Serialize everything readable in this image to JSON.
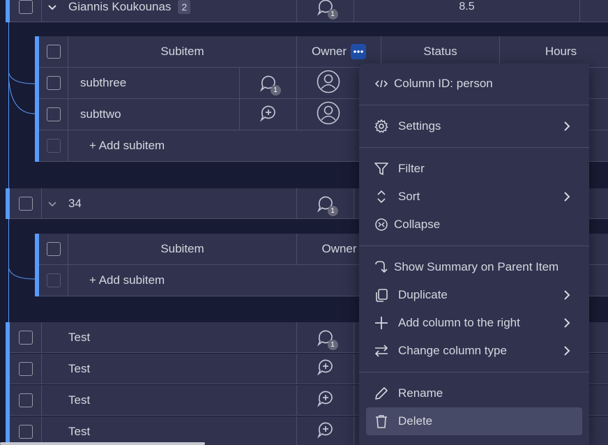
{
  "group1": {
    "name": "Giannis Koukounas",
    "subitem_count": "2",
    "update_count": "1",
    "hours": "8.5"
  },
  "subtable1": {
    "headers": {
      "subitem": "Subitem",
      "owner": "Owner",
      "status": "Status",
      "hours": "Hours"
    },
    "rows": [
      {
        "name": "subthree",
        "update_count": "1"
      },
      {
        "name": "subttwo"
      }
    ],
    "add_label": "+ Add subitem"
  },
  "group2": {
    "name": "34",
    "update_count": "1"
  },
  "subtable2": {
    "headers": {
      "subitem": "Subitem",
      "owner": "Owner"
    },
    "add_label": "+ Add subitem"
  },
  "items": [
    {
      "name": "Test",
      "update_count": "1"
    },
    {
      "name": "Test"
    },
    {
      "name": "Test"
    },
    {
      "name": "Test"
    }
  ],
  "menu": {
    "column_id": "Column ID: person",
    "settings": "Settings",
    "filter": "Filter",
    "sort": "Sort",
    "collapse": "Collapse",
    "show_summary": "Show Summary on Parent Item",
    "duplicate": "Duplicate",
    "add_column_right": "Add column to the right",
    "change_column_type": "Change column type",
    "rename": "Rename",
    "delete": "Delete"
  },
  "colors": {
    "background": "#181b34",
    "row": "#30324e",
    "accent": "#579bfc",
    "menu_highlight": "#474a66"
  }
}
